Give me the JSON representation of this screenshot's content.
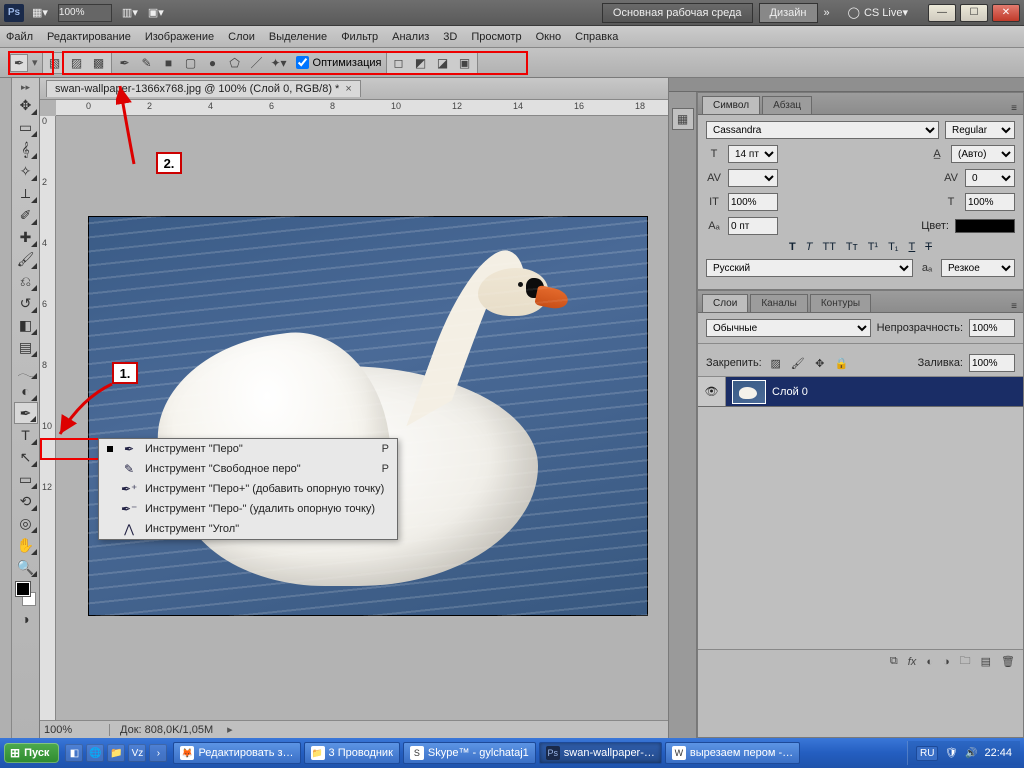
{
  "title_bar": {
    "zoom": "100%",
    "workspace_btn": "Основная рабочая среда",
    "design_btn": "Дизайн",
    "cslive": "CS Live"
  },
  "menu": [
    "Файл",
    "Редактирование",
    "Изображение",
    "Слои",
    "Выделение",
    "Фильтр",
    "Анализ",
    "3D",
    "Просмотр",
    "Окно",
    "Справка"
  ],
  "options_bar": {
    "optimize_label": "Оптимизация"
  },
  "doc_tab": "swan-wallpaper-1366x768.jpg @ 100% (Слой 0, RGB/8) *",
  "ruler_h": [
    "0",
    "2",
    "4",
    "6",
    "8",
    "10",
    "12",
    "14",
    "16",
    "18"
  ],
  "ruler_v": [
    "0",
    "2",
    "4",
    "6",
    "8",
    "10",
    "12"
  ],
  "flyout": {
    "items": [
      {
        "label": "Инструмент \"Перо\"",
        "shortcut": "P",
        "active": true
      },
      {
        "label": "Инструмент \"Свободное перо\"",
        "shortcut": "P"
      },
      {
        "label": "Инструмент \"Перо+\" (добавить опорную точку)",
        "shortcut": ""
      },
      {
        "label": "Инструмент \"Перо-\" (удалить опорную точку)",
        "shortcut": ""
      },
      {
        "label": "Инструмент \"Угол\"",
        "shortcut": ""
      }
    ]
  },
  "callouts": {
    "c1": "1.",
    "c2": "2."
  },
  "status": {
    "zoom": "100%",
    "docsize": "Док: 808,0K/1,05M"
  },
  "char_panel": {
    "tab1": "Символ",
    "tab2": "Абзац",
    "font": "Cassandra",
    "style": "Regular",
    "size": "14 пт",
    "leading": "(Авто)",
    "tracking": "0",
    "vscale": "100%",
    "hscale": "100%",
    "baseline": "0 пт",
    "color_label": "Цвет:",
    "lang": "Русский",
    "aa": "Резкое"
  },
  "layers_panel": {
    "tab1": "Слои",
    "tab2": "Каналы",
    "tab3": "Контуры",
    "blend": "Обычные",
    "opacity_label": "Непрозрачность:",
    "opacity": "100%",
    "lock_label": "Закрепить:",
    "fill_label": "Заливка:",
    "fill": "100%",
    "layer0": "Слой 0"
  },
  "taskbar": {
    "start": "Пуск",
    "tasks": [
      {
        "icon": "🦊",
        "label": "Редактировать з…"
      },
      {
        "icon": "📁",
        "label": "3 Проводник"
      },
      {
        "icon": "S",
        "label": "Skype™ - gylchataj1"
      },
      {
        "icon": "Ps",
        "label": "swan-wallpaper-…",
        "active": true
      },
      {
        "icon": "W",
        "label": "вырезаем пером -…"
      }
    ],
    "lang": "RU",
    "clock": "22:44"
  }
}
